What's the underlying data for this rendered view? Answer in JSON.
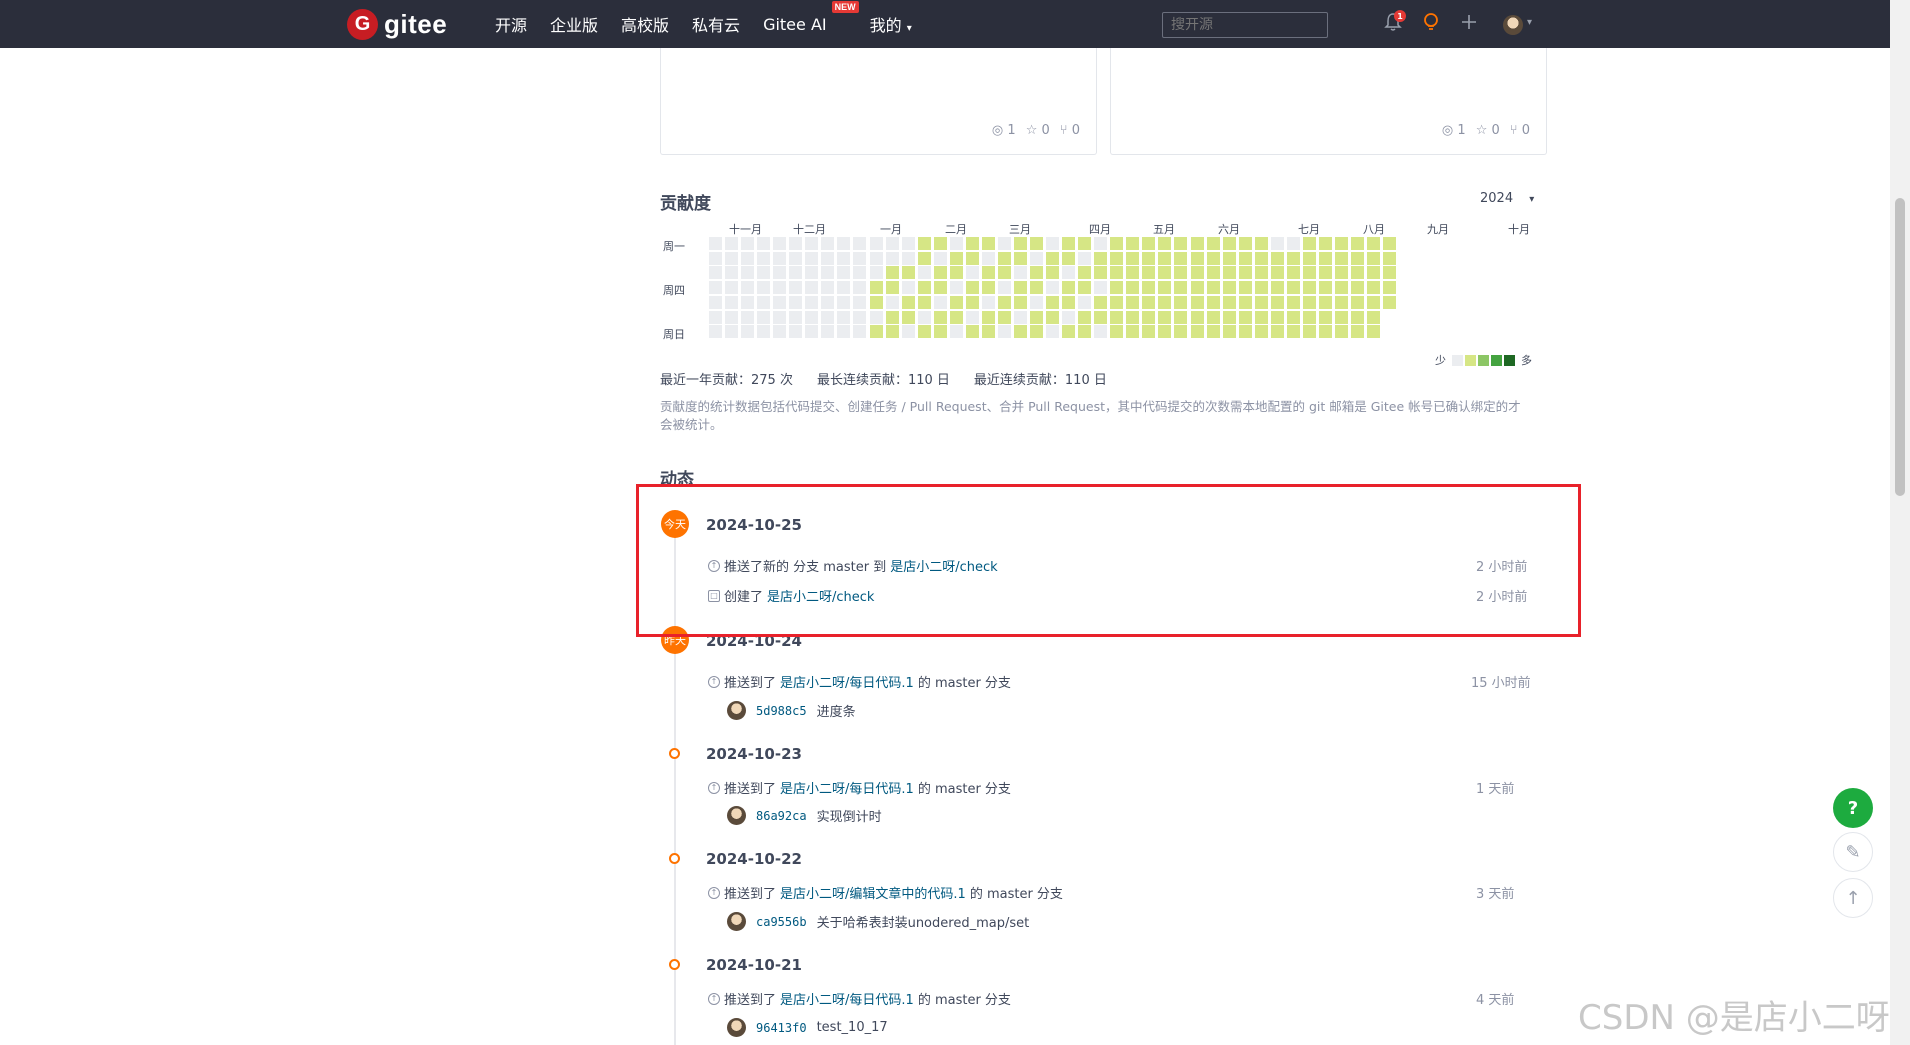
{
  "nav": {
    "logo": "G",
    "logo_text": "gitee",
    "items": [
      "开源",
      "企业版",
      "高校版",
      "私有云",
      "Gitee AI",
      "我的"
    ],
    "new_badge": "NEW",
    "search_placeholder": "搜开源",
    "bell_count": "1"
  },
  "cards": [
    {
      "watch": "1",
      "star": "0",
      "fork": "0"
    },
    {
      "watch": "1",
      "star": "0",
      "fork": "0"
    }
  ],
  "contrib": {
    "title": "贡献度",
    "year": "2024",
    "months": [
      "十一月",
      "十二月",
      "一月",
      "二月",
      "三月",
      "四月",
      "五月",
      "六月",
      "七月",
      "八月",
      "九月",
      "十月"
    ],
    "weekdays": [
      "周一",
      "周四",
      "周日"
    ],
    "legend_less": "少",
    "legend_more": "多",
    "colors": [
      "#ebedf0",
      "#d6e685",
      "#8cc665",
      "#44a340",
      "#1e6823"
    ],
    "stat_year": "最近一年贡献：275 次",
    "stat_longest": "最长连续贡献：110 日",
    "stat_recent": "最近连续贡献：110 日",
    "note": "贡献度的统计数据包括代码提交、创建任务 / Pull Request、合并 Pull Request，其中代码提交的次数需本地配置的 git 邮箱是 Gitee 帐号已确认绑定的才会被统计。"
  },
  "activity": {
    "title": "动态",
    "days": [
      {
        "badge": "今天",
        "date": "2024-10-25",
        "events": [
          {
            "pre": "推送了新的 分支 master 到 ",
            "link": "是店小二呀/check",
            "post": "",
            "time": "2 小时前"
          },
          {
            "pre": "创建了 ",
            "link": "是店小二呀/check",
            "post": "",
            "time": "2 小时前"
          }
        ]
      },
      {
        "badge": "昨天",
        "date": "2024-10-24",
        "events": [
          {
            "pre": "推送到了 ",
            "link": "是店小二呀/每日代码.1",
            "post": " 的 master 分支",
            "time": "15 小时前",
            "sha": "5d988c5",
            "msg": "进度条"
          }
        ]
      },
      {
        "badge": "",
        "date": "2024-10-23",
        "events": [
          {
            "pre": "推送到了 ",
            "link": "是店小二呀/每日代码.1",
            "post": " 的 master 分支",
            "time": "1 天前",
            "sha": "86a92ca",
            "msg": "实现倒计时"
          }
        ]
      },
      {
        "badge": "",
        "date": "2024-10-22",
        "events": [
          {
            "pre": "推送到了 ",
            "link": "是店小二呀/编辑文章中的代码.1",
            "post": " 的 master 分支",
            "time": "3 天前",
            "sha": "ca9556b",
            "msg": "关于哈希表封装unodered_map/set"
          }
        ]
      },
      {
        "badge": "",
        "date": "2024-10-21",
        "events": [
          {
            "pre": "推送到了 ",
            "link": "是店小二呀/每日代码.1",
            "post": " 的 master 分支",
            "time": "4 天前",
            "sha": "96413f0",
            "msg": "test_10_17"
          }
        ]
      }
    ]
  },
  "float": {
    "help": "?",
    "edit": "✎",
    "top": "↑"
  },
  "watermark": "CSDN @是店小二呀"
}
